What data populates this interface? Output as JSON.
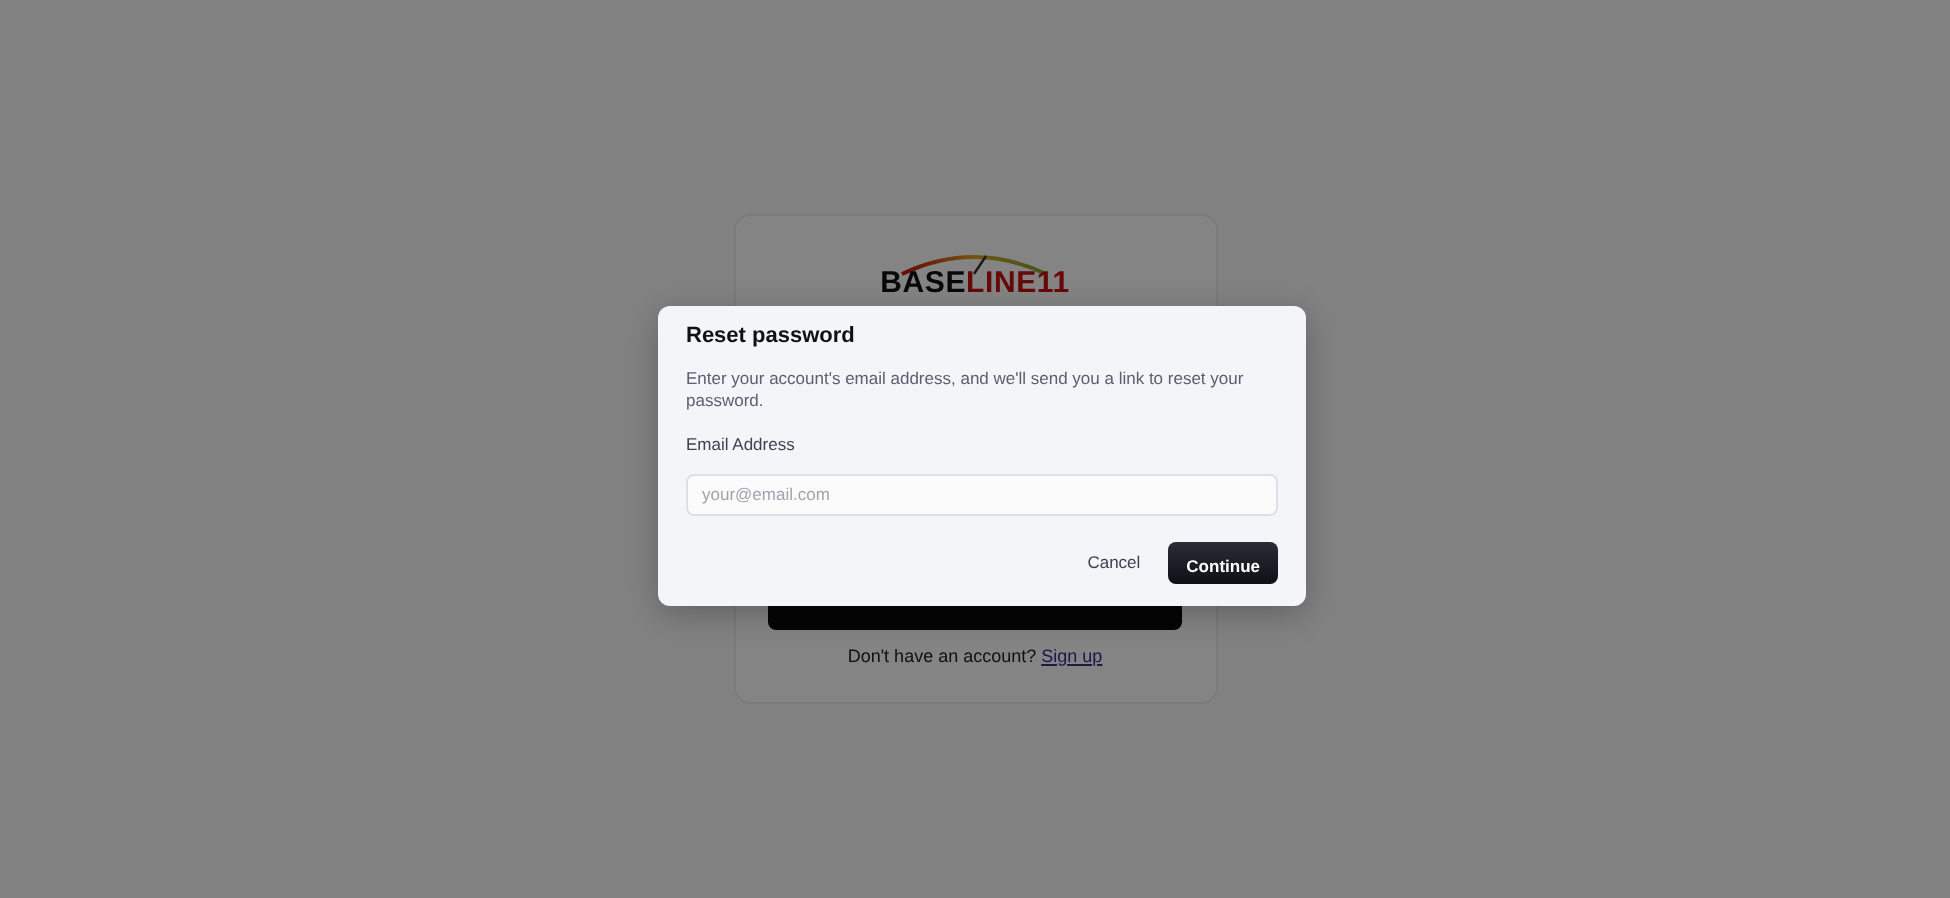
{
  "login_card": {
    "logo": {
      "dark_part": "BASE",
      "red_part": "LINE11"
    },
    "signup_prompt": "Don't have an account?",
    "signup_link": "Sign up"
  },
  "dialog": {
    "title": "Reset password",
    "description": "Enter your account's email address, and we'll send you a link to reset your password.",
    "email_label": "Email Address",
    "email_placeholder": "your@email.com",
    "buttons": [
      {
        "label": "Cancel",
        "kind": "secondary"
      },
      {
        "label": "Continue",
        "kind": "primary"
      }
    ]
  }
}
